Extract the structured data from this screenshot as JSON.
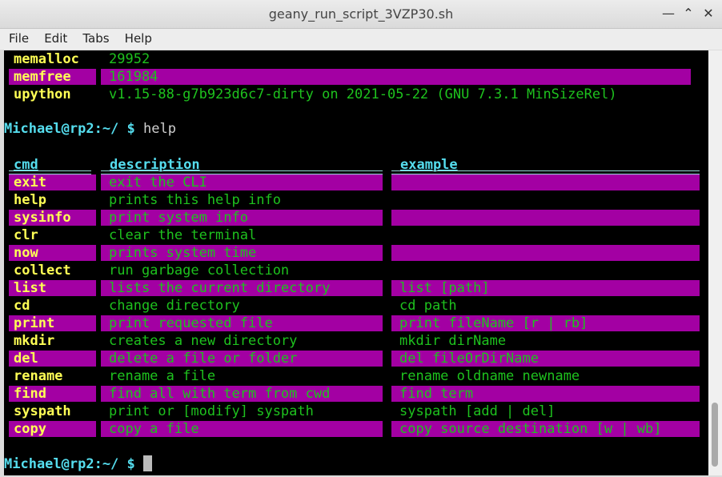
{
  "window": {
    "title": "geany_run_script_3VZP30.sh"
  },
  "menu": [
    "File",
    "Edit",
    "Tabs",
    "Help"
  ],
  "sysinfo": [
    {
      "key": "memalloc",
      "value": "29952",
      "highlight": false
    },
    {
      "key": "memfree",
      "value": "161984",
      "highlight": true
    },
    {
      "key": "upython",
      "value": "v1.15-88-g7b923d6c7-dirty on 2021-05-22 (GNU 7.3.1 MinSizeRel)",
      "highlight": false
    }
  ],
  "prompt1": {
    "prompt": "Michael@rp2:~/ $ ",
    "command": "help"
  },
  "table": {
    "headers": {
      "cmd": "cmd",
      "description": "description",
      "example": "example"
    },
    "rows": [
      {
        "cmd": "exit",
        "description": "exit the CLI",
        "example": "",
        "highlight": true
      },
      {
        "cmd": "help",
        "description": "prints this help info",
        "example": "",
        "highlight": false
      },
      {
        "cmd": "sysinfo",
        "description": "print system info",
        "example": "",
        "highlight": true
      },
      {
        "cmd": "clr",
        "description": "clear the terminal",
        "example": "",
        "highlight": false
      },
      {
        "cmd": "now",
        "description": "prints system time",
        "example": "",
        "highlight": true
      },
      {
        "cmd": "collect",
        "description": "run garbage collection",
        "example": "",
        "highlight": false
      },
      {
        "cmd": "list",
        "description": "lists the current directory",
        "example": "list [path]",
        "highlight": true
      },
      {
        "cmd": "cd",
        "description": "change directory",
        "example": "cd path",
        "highlight": false
      },
      {
        "cmd": "print",
        "description": "print requested file",
        "example": "print fileName [r | rb]",
        "highlight": true
      },
      {
        "cmd": "mkdir",
        "description": "creates a new directory",
        "example": "mkdir dirName",
        "highlight": false
      },
      {
        "cmd": "del",
        "description": "delete a file or folder",
        "example": "del fileOrDirName",
        "highlight": true
      },
      {
        "cmd": "rename",
        "description": "rename a file",
        "example": "rename oldname newname",
        "highlight": false
      },
      {
        "cmd": "find",
        "description": "find all with term from cwd",
        "example": "find term",
        "highlight": true
      },
      {
        "cmd": "syspath",
        "description": "print or [modify] syspath",
        "example": "syspath [add | del]",
        "highlight": false
      },
      {
        "cmd": "copy",
        "description": "copy a file",
        "example": "copy source destination [w | wb]",
        "highlight": true
      }
    ]
  },
  "prompt2": {
    "prompt": "Michael@rp2:~/ $ ",
    "command": ""
  },
  "icons": {
    "minimize": "minimize-icon",
    "maximize": "maximize-icon",
    "close": "close-icon"
  }
}
